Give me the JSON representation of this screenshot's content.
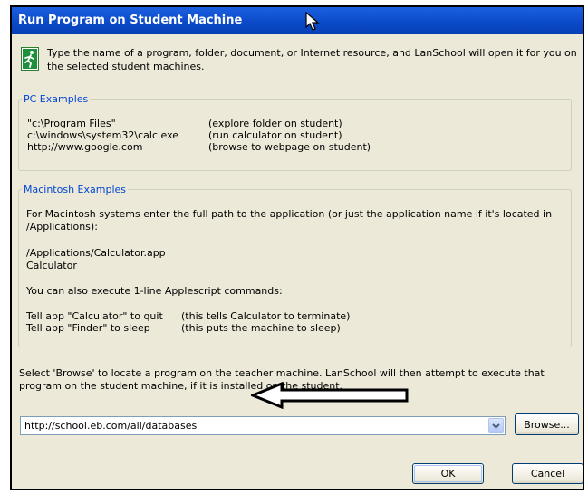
{
  "window": {
    "title": "Run Program on Student Machine"
  },
  "intro": "Type the name of a program, folder, document, or Internet resource, and LanSchool will open it for you on the selected student machines.",
  "pc_examples": {
    "legend": "PC Examples",
    "rows": [
      {
        "path": "\"c:\\Program Files\"",
        "note": "(explore folder on student)"
      },
      {
        "path": "c:\\windows\\system32\\calc.exe",
        "note": "(run calculator on student)"
      },
      {
        "path": "http://www.google.com",
        "note": "(browse to webpage on student)"
      }
    ]
  },
  "mac_examples": {
    "legend": "Macintosh Examples",
    "para1": "For Macintosh systems enter the full path to the application (or just the application name if it's located in /Applications):",
    "app_path": "/Applications/Calculator.app",
    "app_name": "Calculator",
    "para2": "You can also execute 1-line Applescript commands:",
    "rows": [
      {
        "cmd": "Tell app \"Calculator\" to quit",
        "note": "(this tells Calculator to terminate)"
      },
      {
        "cmd": "Tell app \"Finder\" to sleep",
        "note": "(this puts the machine to sleep)"
      }
    ]
  },
  "browse_note": "Select 'Browse' to locate a program on the teacher machine. LanSchool will then attempt to execute that program on the student machine, if it is installed on the student.",
  "command_input": {
    "value": "http://school.eb.com/all/databases"
  },
  "buttons": {
    "browse": "Browse...",
    "ok": "OK",
    "cancel": "Cancel"
  },
  "icons": {
    "run": "running-person-icon",
    "dropdown": "chevron-down-icon",
    "cursor": "mouse-pointer-icon",
    "annotation": "left-arrow-icon"
  },
  "colors": {
    "title_bar": "#0a49c7",
    "dialog_bg": "#ece9d8",
    "group_legend": "#0046d5",
    "button_border": "#003c74"
  }
}
